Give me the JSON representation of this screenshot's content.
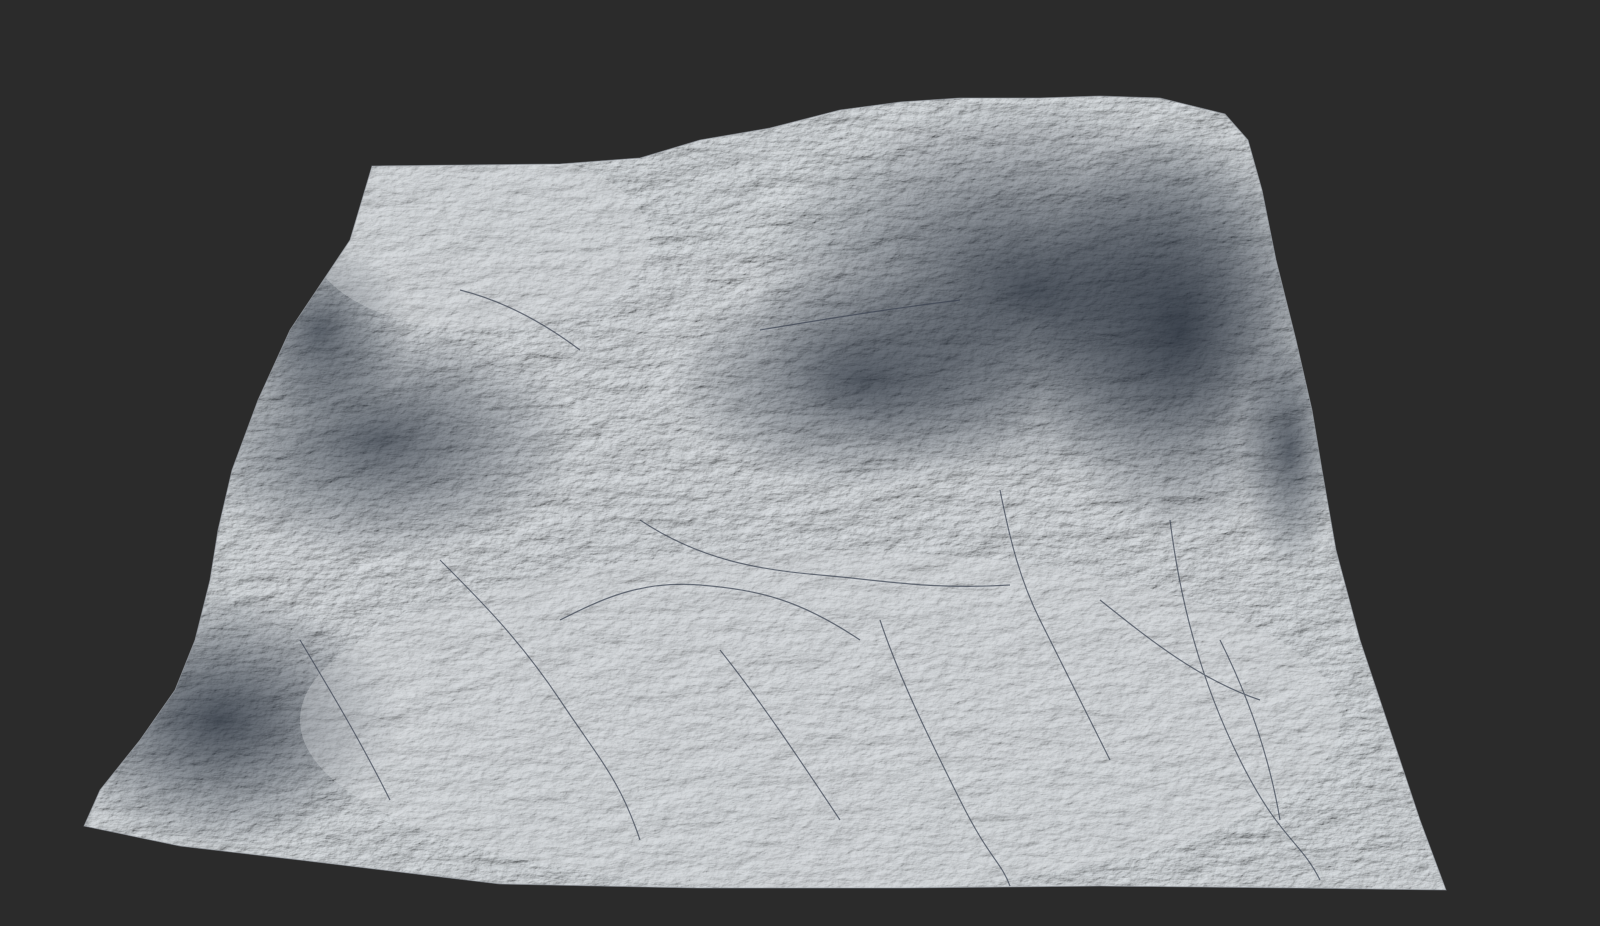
{
  "viewport": {
    "background_color": "#2b2b2b"
  },
  "terrain": {
    "surface_color": "#b9bec3",
    "shadow_color": "#28303c",
    "highlight_color": "#e4e7ea",
    "channel_color": "#3a4250"
  }
}
